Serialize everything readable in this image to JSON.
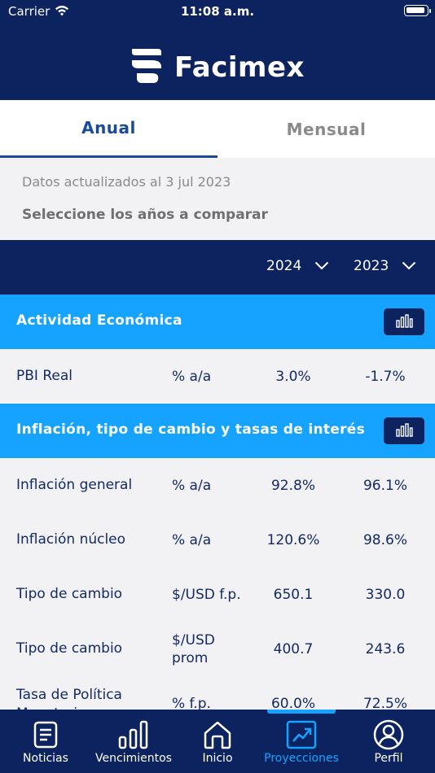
{
  "status_bar": {
    "carrier": "Carrier",
    "time": "11:08 a.m."
  },
  "brand": {
    "name": "Facimex"
  },
  "tabs": [
    {
      "label": "Anual"
    },
    {
      "label": "Mensual"
    }
  ],
  "info": {
    "updated": "Datos actualizados al 3 jul 2023",
    "select_prompt": "Seleccione los años a comparar"
  },
  "years": [
    {
      "value": "2024"
    },
    {
      "value": "2023"
    }
  ],
  "sections": [
    {
      "title": "Actividad Económica",
      "rows": [
        {
          "label": "PBI Real",
          "unit": "% a/a",
          "v1": "3.0%",
          "v2": "-1.7%"
        }
      ]
    },
    {
      "title": "Inflación, tipo de cambio y tasas de interés",
      "rows": [
        {
          "label": "Inflación general",
          "unit": "% a/a",
          "v1": "92.8%",
          "v2": "96.1%"
        },
        {
          "label": "Inflación núcleo",
          "unit": "% a/a",
          "v1": "120.6%",
          "v2": "98.6%"
        },
        {
          "label": "Tipo de cambio",
          "unit": "$/USD f.p.",
          "v1": "650.1",
          "v2": "330.0"
        },
        {
          "label": "Tipo de cambio",
          "unit": "$/USD prom",
          "v1": "400.7",
          "v2": "243.6"
        },
        {
          "label": "Tasa de Política Monetaria",
          "unit": "% f.p.",
          "v1": "60.0%",
          "v2": "72.5%"
        }
      ]
    }
  ],
  "nav": [
    {
      "label": "Noticias",
      "icon": "news-icon"
    },
    {
      "label": "Vencimientos",
      "icon": "bar-chart-icon"
    },
    {
      "label": "Inicio",
      "icon": "home-icon"
    },
    {
      "label": "Proyecciones",
      "icon": "trend-up-icon",
      "active": true
    },
    {
      "label": "Perfil",
      "icon": "user-icon"
    }
  ],
  "colors": {
    "navy": "#0d2360",
    "accent": "#15a3ff",
    "tab_active": "#1a4a9c"
  }
}
